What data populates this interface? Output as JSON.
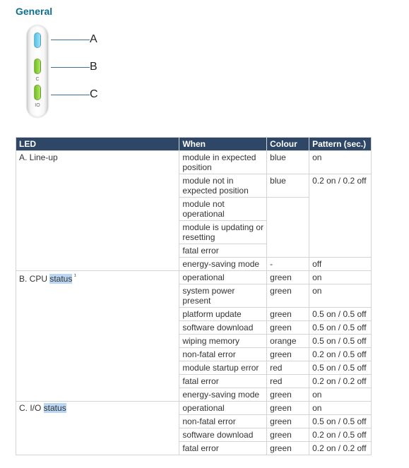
{
  "section_title": "General",
  "diagram": {
    "callouts": {
      "a": "A",
      "b": "B",
      "c": "C"
    },
    "panel_labels": {
      "mid": "C",
      "bottom": "IO"
    }
  },
  "table": {
    "headers": {
      "led": "LED",
      "when": "When",
      "colour": "Colour",
      "pattern": "Pattern (sec.)"
    },
    "groups": [
      {
        "led_label": "A. Line-up",
        "highlight": null,
        "sup": null,
        "rows": [
          {
            "when": "module in expected position",
            "colour": "blue",
            "pattern": "on"
          },
          {
            "when": "module not in expected position",
            "colour": "blue",
            "pattern": "0.2 on / 0.2 off"
          },
          {
            "when": "module not operational",
            "colour": "",
            "pattern": ""
          },
          {
            "when": "module is updating or resetting",
            "colour": "",
            "pattern": ""
          },
          {
            "when": "fatal error",
            "colour": "",
            "pattern": ""
          },
          {
            "when": "energy-saving mode",
            "colour": "-",
            "pattern": "off"
          }
        ]
      },
      {
        "led_label_prefix": "B. CPU ",
        "highlight": "status",
        "sup": " ¹",
        "rows": [
          {
            "when": "operational",
            "colour": "green",
            "pattern": "on"
          },
          {
            "when": "system power present",
            "colour": "green",
            "pattern": "on"
          },
          {
            "when": "platform update",
            "colour": "green",
            "pattern": "0.5 on / 0.5 off"
          },
          {
            "when": "software download",
            "colour": "green",
            "pattern": "0.5 on / 0.5 off"
          },
          {
            "when": "wiping memory",
            "colour": "orange",
            "pattern": "0.5 on / 0.5 off"
          },
          {
            "when": "non-fatal error",
            "colour": "green",
            "pattern": "0.2 on / 0.5 off"
          },
          {
            "when": "module startup error",
            "colour": "red",
            "pattern": "0.5 on / 0.5 off"
          },
          {
            "when": "fatal error",
            "colour": "red",
            "pattern": "0.2 on / 0.2 off"
          },
          {
            "when": "energy-saving mode",
            "colour": "green",
            "pattern": "on"
          }
        ]
      },
      {
        "led_label_prefix": "C. I/O ",
        "highlight": "status",
        "sup": null,
        "rows": [
          {
            "when": "operational",
            "colour": "green",
            "pattern": "on"
          },
          {
            "when": "non-fatal error",
            "colour": "green",
            "pattern": "0.5 on / 0.5 off"
          },
          {
            "when": "software download",
            "colour": "green",
            "pattern": "0.2 on / 0.5 off"
          },
          {
            "when": "fatal error",
            "colour": "green",
            "pattern": "0.2 on / 0.2 off"
          }
        ]
      }
    ]
  }
}
